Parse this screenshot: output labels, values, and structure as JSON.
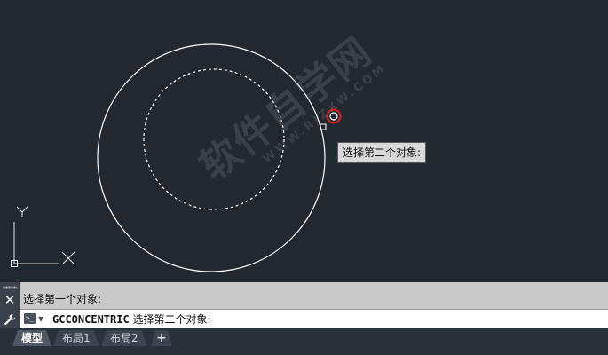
{
  "canvas": {
    "tooltip": "选择第二个对象:",
    "watermark": {
      "text": "软件自学网",
      "url": "WWW.RJZXW.COM"
    },
    "axis_labels": {
      "y": "Y",
      "x": "X"
    },
    "colors": {
      "background": "#212830",
      "geometry": "#ffffff",
      "cursor_marker": "#d02020"
    }
  },
  "command_line": {
    "history": "选择第一个对象:",
    "prompt_icon": "command-prompt-icon",
    "command": "GCCONCENTRIC",
    "prompt": "选择第二个对象:"
  },
  "layout_tabs": {
    "tabs": [
      {
        "label": "模型",
        "active": true
      },
      {
        "label": "布局1",
        "active": false
      },
      {
        "label": "布局2",
        "active": false
      }
    ],
    "add_label": "+"
  }
}
